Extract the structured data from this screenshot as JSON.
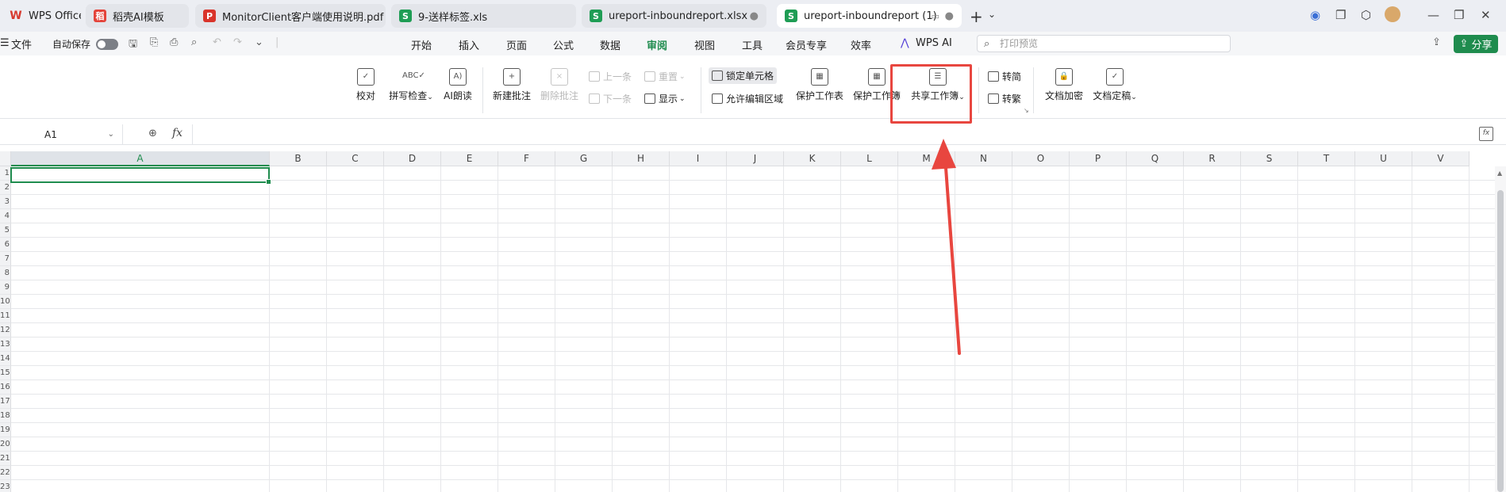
{
  "tabs": [
    {
      "label": "WPS Office",
      "icon": "wps-logo-icon",
      "state": "inactive"
    },
    {
      "label": "稻壳AI模板",
      "icon": "docer-icon",
      "state": "inactive"
    },
    {
      "label": "MonitorClient客户端使用说明.pdf",
      "icon": "pdf-icon",
      "state": "inactive"
    },
    {
      "label": "9-送样标签.xls",
      "icon": "sheet-icon",
      "state": "inactive"
    },
    {
      "label": "ureport-inboundreport.xlsx",
      "icon": "sheet-icon",
      "state": "inactive"
    },
    {
      "label": "ureport-inboundreport (1)",
      "icon": "sheet-icon",
      "state": "active"
    }
  ],
  "toolbar": {
    "file_label": "文件",
    "autosave_label": "自动保存",
    "menu_tabs": [
      "开始",
      "插入",
      "页面",
      "公式",
      "数据",
      "审阅",
      "视图",
      "工具",
      "会员专享",
      "效率"
    ],
    "active_tab": "审阅",
    "wps_ai_label": "WPS AI",
    "search_placeholder": "打印预览",
    "share_label": "分享"
  },
  "ribbon": {
    "proofread": "校对",
    "spellcheck": "拼写检查",
    "ai_read": "AI朗读",
    "new_comment": "新建批注",
    "delete_comment": "删除批注",
    "prev": "上一条",
    "next": "下一条",
    "reset": "重置",
    "show": "显示",
    "lock_cells": "锁定单元格",
    "allow_edit_range": "允许编辑区域",
    "protect_sheet": "保护工作表",
    "protect_workbook": "保护工作簿",
    "share_workbook": "共享工作簿",
    "to_simplified": "转简",
    "to_traditional": "转繁",
    "doc_encrypt": "文档加密",
    "doc_finalize": "文档定稿"
  },
  "formula_bar": {
    "name_box": "A1",
    "fx_label": "fx",
    "formula": ""
  },
  "grid": {
    "columns": [
      "A",
      "B",
      "C",
      "D",
      "E",
      "F",
      "G",
      "H",
      "I",
      "J",
      "K",
      "L",
      "M",
      "N",
      "O",
      "P",
      "Q",
      "R",
      "S",
      "T",
      "U",
      "V"
    ],
    "rows": [
      "1",
      "2",
      "3",
      "4",
      "5",
      "6",
      "7",
      "8",
      "9",
      "10",
      "11",
      "12",
      "13",
      "14",
      "15",
      "16",
      "17",
      "18",
      "19",
      "20",
      "21",
      "22",
      "23"
    ],
    "selected_cell": "A1"
  },
  "colors": {
    "accent": "#1f8c4e",
    "annotation_red": "#e8463f",
    "tab_bar_bg": "#eceef3"
  }
}
